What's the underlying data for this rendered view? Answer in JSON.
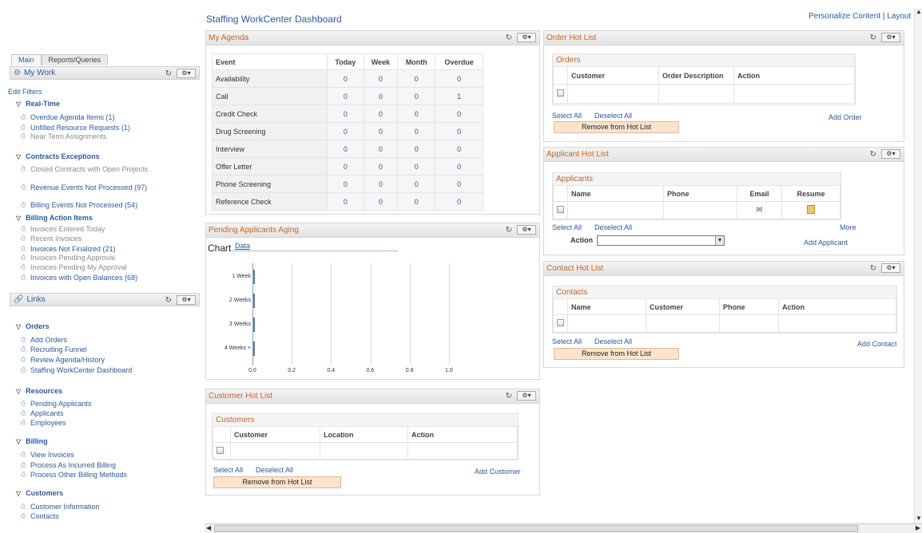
{
  "page_title": "Staffing WorkCenter Dashboard",
  "top_link": "Personalize Content | Layout",
  "left": {
    "tabs": [
      "Main",
      "Reports/Queries"
    ],
    "my_work": {
      "title": "My Work",
      "edit_filters": "Edit Filters",
      "sections": [
        {
          "label": "Real-Time",
          "items": [
            {
              "text": "Overdue Agenda Items (1)",
              "dim": false
            },
            {
              "text": "Unfilled Resource Requests (1)",
              "dim": false
            },
            {
              "text": "Near Term Assignments",
              "dim": true
            }
          ]
        },
        {
          "label": "Contracts Exceptions",
          "items": [
            {
              "text": "Closed Contracts with Open Projects",
              "dim": true
            },
            {
              "text": "Revenue Events Not Processed (97)",
              "dim": false
            },
            {
              "text": "Billing Events Not Processed (54)",
              "dim": false
            }
          ]
        },
        {
          "label": "Billing Action Items",
          "items": [
            {
              "text": "Invoices Entered Today",
              "dim": true
            },
            {
              "text": "Recent Invoices",
              "dim": true
            },
            {
              "text": "Invoices Not Finalized (21)",
              "dim": false
            },
            {
              "text": "Invoices Pending Approval",
              "dim": true
            },
            {
              "text": "Invoices Pending My Approval",
              "dim": true
            },
            {
              "text": "Invoices with Open Balances (68)",
              "dim": false
            }
          ]
        }
      ]
    },
    "links": {
      "title": "Links",
      "sections": [
        {
          "label": "Orders",
          "items": [
            "Add Orders",
            "Recruiting Funnel",
            "Review Agenda/History",
            "Staffing WorkCenter Dashboard"
          ]
        },
        {
          "label": "Resources",
          "items": [
            "Pending Applicants",
            "Applicants",
            "Employees"
          ]
        },
        {
          "label": "Billing",
          "items": [
            "View Invoices",
            "Process As Incurred Billing",
            "Process Other Billing Methods"
          ]
        },
        {
          "label": "Customers",
          "items": [
            "Customer Information",
            "Contacts"
          ]
        }
      ]
    }
  },
  "agenda": {
    "title": "My Agenda",
    "headers": [
      "Event",
      "Today",
      "Week",
      "Month",
      "Overdue"
    ],
    "rows": [
      [
        "Availability",
        "0",
        "0",
        "0",
        "0"
      ],
      [
        "Call",
        "0",
        "0",
        "0",
        "1"
      ],
      [
        "Credit Check",
        "0",
        "0",
        "0",
        "0"
      ],
      [
        "Drug Screening",
        "0",
        "0",
        "0",
        "0"
      ],
      [
        "Interview",
        "0",
        "0",
        "0",
        "0"
      ],
      [
        "Offer Letter",
        "0",
        "0",
        "0",
        "0"
      ],
      [
        "Phone Screening",
        "0",
        "0",
        "0",
        "0"
      ],
      [
        "Reference Check",
        "0",
        "0",
        "0",
        "0"
      ]
    ]
  },
  "aging": {
    "title": "Pending Applicants Aging",
    "tab_chart": "Chart",
    "tab_data": "Data"
  },
  "chart_data": {
    "type": "bar",
    "orientation": "horizontal",
    "categories": [
      "1 Week",
      "2 Weeks",
      "3 Weeks",
      "4 Weeks +"
    ],
    "values": [
      0,
      0,
      0,
      0
    ],
    "xlim": [
      0,
      1.0
    ],
    "xticks": [
      "0.0",
      "0.2",
      "0.4",
      "0.6",
      "0.8",
      "1.0"
    ],
    "grid": true
  },
  "customer_hot": {
    "title": "Customer Hot List",
    "box_title": "Customers",
    "headers": [
      "Customer",
      "Location",
      "Action"
    ],
    "select_all": "Select All",
    "deselect_all": "Deselect All",
    "add": "Add Customer",
    "remove": "Remove from Hot List"
  },
  "order_hot": {
    "title": "Order Hot List",
    "box_title": "Orders",
    "headers": [
      "Customer",
      "Order Description",
      "Action"
    ],
    "select_all": "Select All",
    "deselect_all": "Deselect All",
    "add": "Add Order",
    "remove": "Remove from Hot List"
  },
  "applicant_hot": {
    "title": "Applicant Hot List",
    "box_title": "Applicants",
    "headers": [
      "Name",
      "Phone",
      "Email",
      "Resume"
    ],
    "select_all": "Select All",
    "deselect_all": "Deselect All",
    "more": "More",
    "action_label": "Action",
    "add": "Add Applicant"
  },
  "contact_hot": {
    "title": "Contact Hot List",
    "box_title": "Contacts",
    "headers": [
      "Name",
      "Customer",
      "Phone",
      "Action"
    ],
    "select_all": "Select All",
    "deselect_all": "Deselect All",
    "add": "Add Contact",
    "remove": "Remove from Hot List"
  }
}
